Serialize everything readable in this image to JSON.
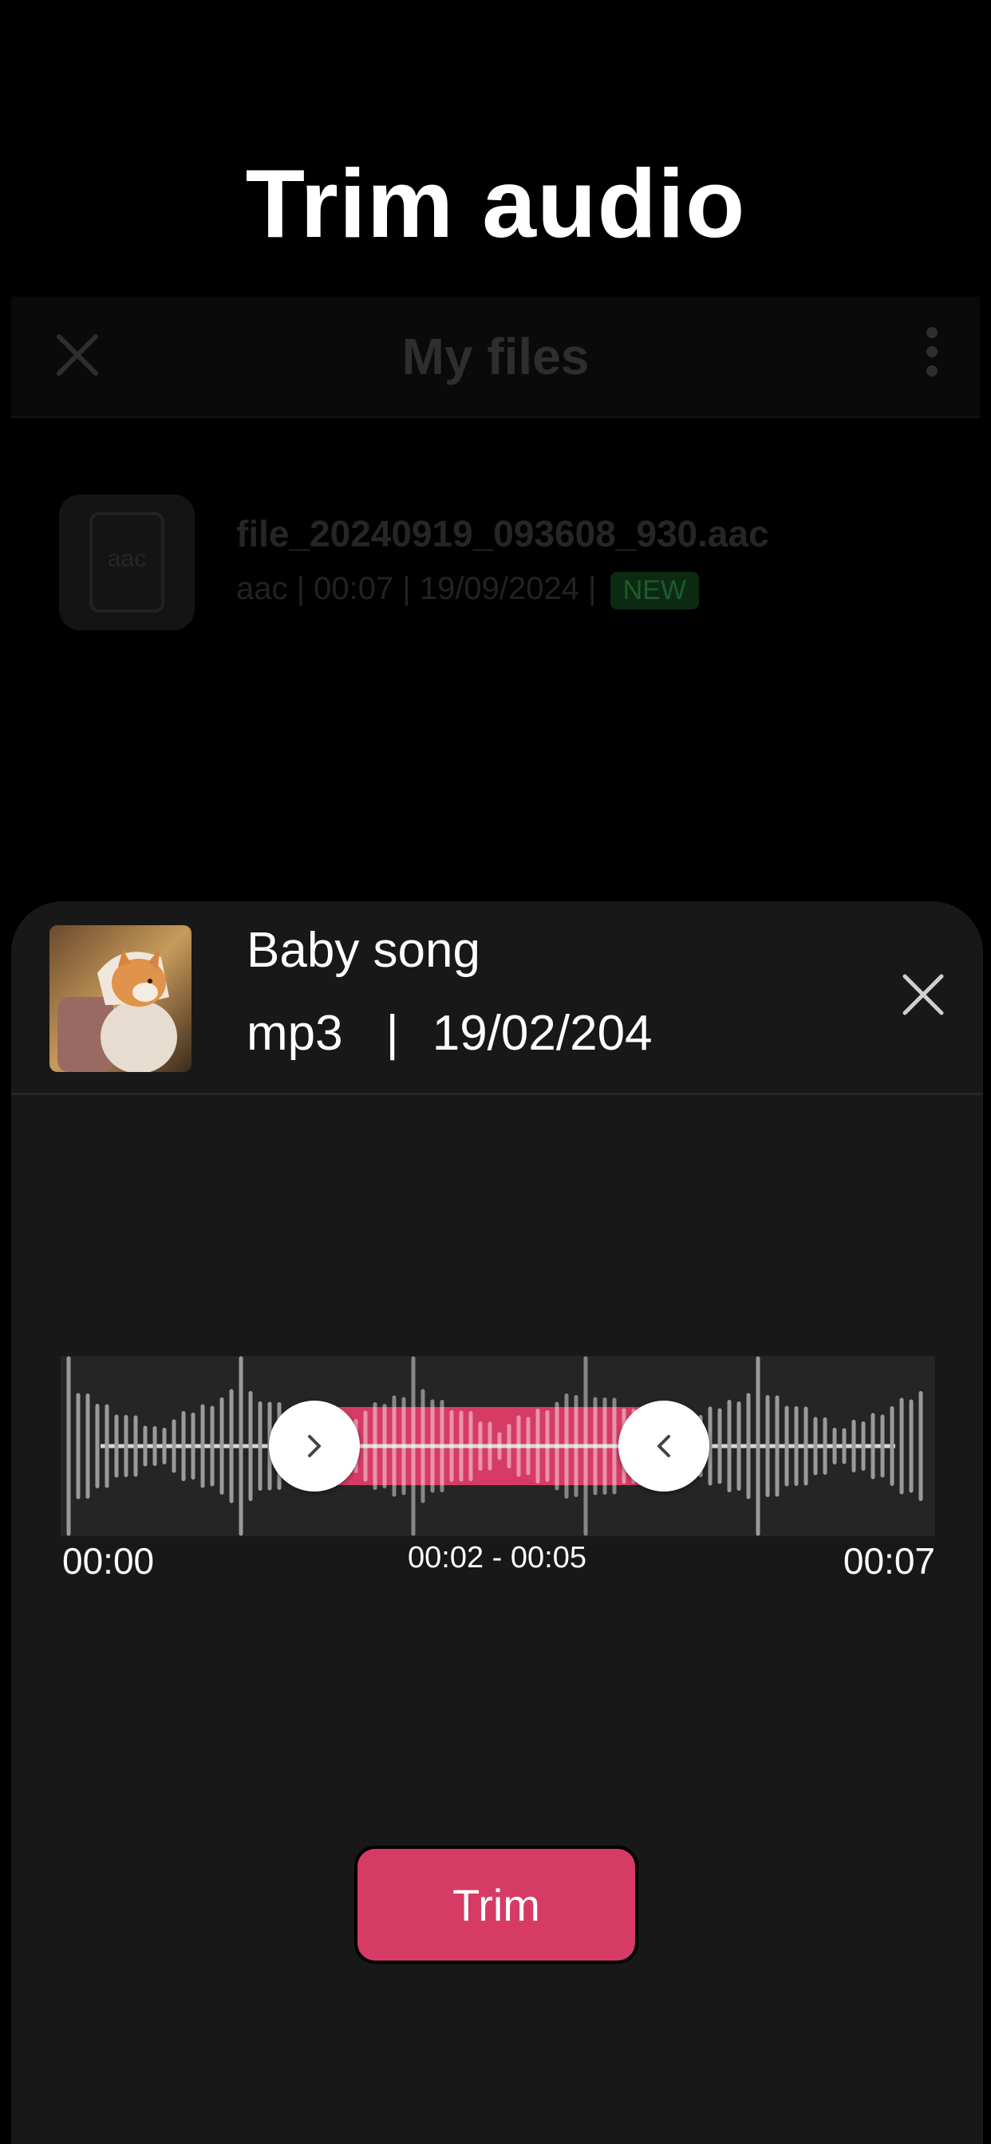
{
  "headline": "Trim audio",
  "background_screen": {
    "title": "My files",
    "file": {
      "name": "file_20240919_093608_930.aac",
      "thumb_ext": "aac",
      "meta": "aac | 00:07 | 19/09/2024 |",
      "badge": "NEW"
    }
  },
  "sheet": {
    "song_title": "Baby song",
    "format": "mp3",
    "separator": "|",
    "date": "19/02/204",
    "trim": {
      "start_label": "00:00",
      "range_label": "00:02 - 00:05",
      "end_label": "00:07",
      "selection_start_fraction": 0.29,
      "selection_end_fraction": 0.69
    },
    "trim_button": "Trim"
  },
  "colors": {
    "accent": "#d63b65",
    "sheet_bg": "#181818",
    "wave_bg": "#252525"
  },
  "icons": [
    "close-icon",
    "more-vert-icon",
    "file-icon",
    "chevron-right-icon",
    "chevron-left-icon"
  ]
}
